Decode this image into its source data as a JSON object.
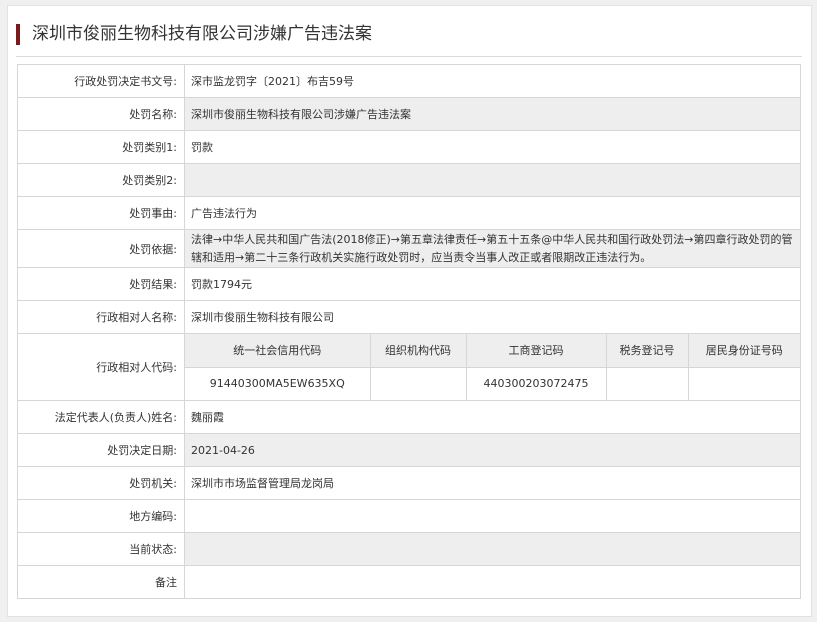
{
  "page_title": "深圳市俊丽生物科技有限公司涉嫌广告违法案",
  "rows": [
    {
      "label": "行政处罚决定书文号:",
      "value": "深市监龙罚字〔2021〕布吉59号"
    },
    {
      "label": "处罚名称:",
      "value": "深圳市俊丽生物科技有限公司涉嫌广告违法案"
    },
    {
      "label": "处罚类别1:",
      "value": "罚款"
    },
    {
      "label": "处罚类别2:",
      "value": ""
    },
    {
      "label": "处罚事由:",
      "value": "广告违法行为"
    },
    {
      "label": "处罚依据:",
      "value": "法律→中华人民共和国广告法(2018修正)→第五章法律责任→第五十五条@中华人民共和国行政处罚法→第四章行政处罚的管辖和适用→第二十三条行政机关实施行政处罚时，应当责令当事人改正或者限期改正违法行为。"
    },
    {
      "label": "处罚结果:",
      "value": "罚款1794元"
    },
    {
      "label": "行政相对人名称:",
      "value": "深圳市俊丽生物科技有限公司"
    }
  ],
  "codes": {
    "label": "行政相对人代码:",
    "headers": [
      "统一社会信用代码",
      "组织机构代码",
      "工商登记码",
      "税务登记号",
      "居民身份证号码"
    ],
    "values": [
      "91440300MA5EW635XQ",
      "",
      "440300203072475",
      "",
      ""
    ]
  },
  "rows_after": [
    {
      "label": "法定代表人(负责人)姓名:",
      "value": "魏丽霞"
    },
    {
      "label": "处罚决定日期:",
      "value": "2021-04-26"
    },
    {
      "label": "处罚机关:",
      "value": "深圳市市场监督管理局龙岗局"
    },
    {
      "label": "地方编码:",
      "value": ""
    },
    {
      "label": "当前状态:",
      "value": ""
    },
    {
      "label": "备注",
      "value": ""
    }
  ]
}
